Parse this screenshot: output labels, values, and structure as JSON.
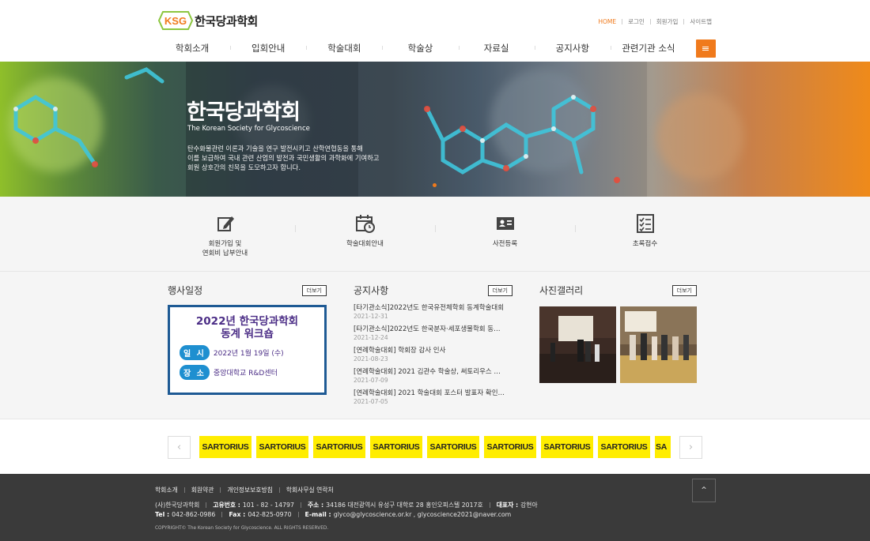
{
  "brand": {
    "logo_mark": "KSG",
    "name": "한국당과학회",
    "accent": "#f07a1c"
  },
  "top_links": [
    "HOME",
    "로그인",
    "회원가입",
    "사이트맵"
  ],
  "nav": [
    "학회소개",
    "입회안내",
    "학술대회",
    "학술상",
    "자료실",
    "공지사항",
    "관련기관 소식"
  ],
  "hero": {
    "title": "한국당과학회",
    "subtitle": "The Korean Society for Glycoscience",
    "desc1": "탄수화물관련 이론과 기술을 연구 발전시키고 산학연협동을 통해",
    "desc2": "이를 보급하여 국내 관련 산업의 발전과 국민생활의 과학화에 기여하고",
    "desc3": "회원 상호간의 친목을 도모하고자 합니다."
  },
  "quick": [
    {
      "label1": "회원가입 및",
      "label2": "연회비 납부안내",
      "icon": "pencil-edit-icon"
    },
    {
      "label1": "학술대회안내",
      "label2": "",
      "icon": "calendar-clock-icon"
    },
    {
      "label1": "사전등록",
      "label2": "",
      "icon": "id-card-icon"
    },
    {
      "label1": "초록접수",
      "label2": "",
      "icon": "checklist-icon"
    }
  ],
  "events": {
    "title": "행사일정",
    "more": "더보기",
    "card": {
      "title1": "2022년 한국당과학회",
      "title2": "동계 워크숍",
      "date_tag": "일 시",
      "date": "2022년 1월 19일 (수)",
      "place_tag": "장 소",
      "place": "중앙대학교 R&D센터"
    }
  },
  "notices": {
    "title": "공지사항",
    "more": "더보기",
    "items": [
      {
        "title": "[타기관소식]2022년도 한국유전체학회 동계학술대회",
        "date": "2021-12-31"
      },
      {
        "title": "[타기관소식]2022년도 한국분자·세포생물학회 동…",
        "date": "2021-12-24"
      },
      {
        "title": "[연례학술대회] 학회장 감사 인사",
        "date": "2021-08-23"
      },
      {
        "title": "[연례학술대회] 2021 김관수 학술상, 써토리우스 …",
        "date": "2021-07-09"
      },
      {
        "title": "[연례학술대회] 2021 학술대회 포스터 발표자 확인…",
        "date": "2021-07-05"
      }
    ]
  },
  "gallery": {
    "title": "사진갤러리",
    "more": "더보기"
  },
  "sponsors": {
    "logo_text": "SARTORIUS",
    "partial": "SA",
    "count": 8
  },
  "footer": {
    "nav": [
      "학회소개",
      "회원약관",
      "개인정보보호방침",
      "학회사무실 연락처"
    ],
    "org": "(사)한국당과학회",
    "reg_label": "고유번호 :",
    "reg": "101 - 82 - 14797",
    "addr_label": "주소 :",
    "addr": "34186 대전광역시 유성구 대학로 28 홍인오피스텔 2017호",
    "ceo_label": "대표자 :",
    "ceo": "강현아",
    "tel_label": "Tel :",
    "tel": "042-862-0986",
    "fax_label": "Fax :",
    "fax": "042-825-0970",
    "email_label": "E-mail :",
    "email": "glyco@glycoscience.or.kr , glycoscience2021@naver.com",
    "copyright": "COPYRIGHT© The Korean Society for Glycoscience. ALL RIGHTS RESERVED."
  }
}
